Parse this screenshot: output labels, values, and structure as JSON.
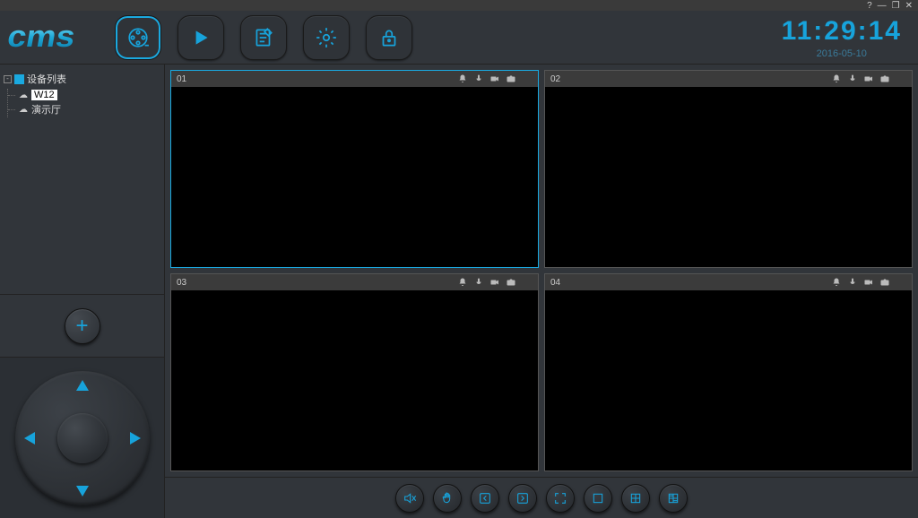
{
  "titlebar": {
    "help": "?",
    "min": "—",
    "max": "❐",
    "close": "✕"
  },
  "clock": {
    "time": "11:29:14",
    "date": "2016-05-10"
  },
  "tree": {
    "root_label": "设备列表",
    "items": [
      {
        "label": "W12",
        "selected": true
      },
      {
        "label": "演示厅",
        "selected": false
      }
    ]
  },
  "cells": [
    {
      "num": "01"
    },
    {
      "num": "02"
    },
    {
      "num": "03"
    },
    {
      "num": "04"
    }
  ],
  "icons": {
    "bell": "bell",
    "mic": "mic",
    "cam": "cam",
    "snap": "snap",
    "close": "close"
  }
}
